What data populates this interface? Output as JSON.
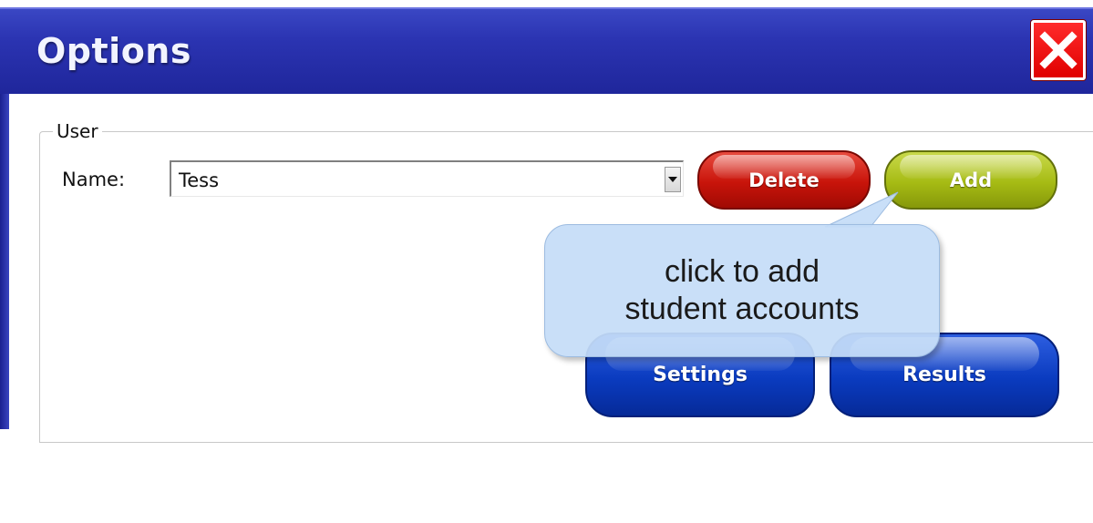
{
  "window": {
    "title": "Options",
    "close_icon": "close-x-icon"
  },
  "user_group": {
    "label": "User",
    "name_label": "Name:",
    "name_value": "Tess",
    "delete_label": "Delete",
    "add_label": "Add"
  },
  "tooltip": {
    "line1": "click to add",
    "line2": "student accounts"
  },
  "bottom_buttons": {
    "settings_label": "Settings",
    "results_label": "Results"
  },
  "colors": {
    "titlebar": "#2b34b2",
    "close": "#e00000",
    "delete": "#c8140a",
    "add": "#a6bb14",
    "nav": "#0a3bbf",
    "tooltip": "#c5ddf7"
  }
}
